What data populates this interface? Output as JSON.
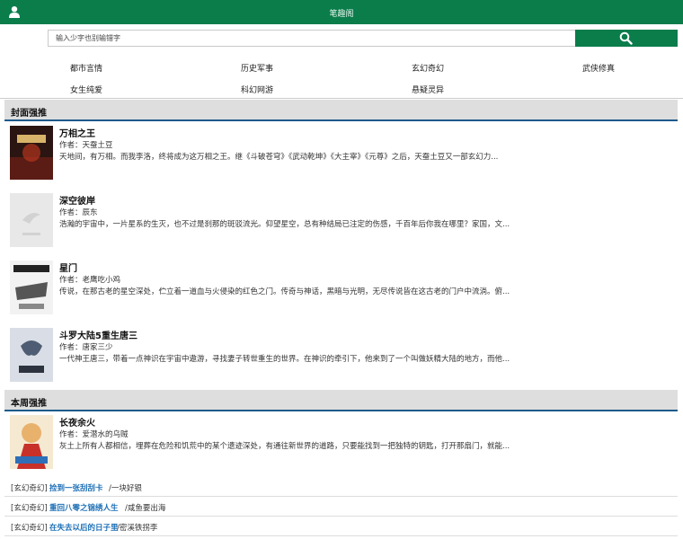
{
  "header": {
    "title": "笔趣阁",
    "user_icon": "user-icon"
  },
  "search": {
    "placeholder": "输入少字也别输错字",
    "button_icon": "search-icon"
  },
  "categories": [
    "都市言情",
    "历史军事",
    "玄幻奇幻",
    "武侠修真",
    "女生纯爱",
    "科幻网游",
    "悬疑灵异"
  ],
  "sections": {
    "cover": {
      "title": "封面强推"
    },
    "weekly": {
      "title": "本周强推"
    }
  },
  "cover_books": [
    {
      "title": "万相之王",
      "author": "作者：天蚕土豆",
      "desc": "天地间，有万相。而我李洛，终将成为这万相之王。继《斗破苍穹》《武动乾坤》《大主宰》《元尊》之后，天蚕土豆又一部玄幻力..."
    },
    {
      "title": "深空彼岸",
      "author": "作者：辰东",
      "desc": "浩瀚的宇宙中，一片星系的生灭，也不过是刹那的斑驳流光。仰望星空，总有种结局已注定的伤感，千百年后你我在哪里？家国，文..."
    },
    {
      "title": "星门",
      "author": "作者：老鹰吃小鸡",
      "desc": "传说，在那古老的星空深处，伫立着一道血与火侵染的红色之门。传奇与神话，黑暗与光明，无尽传说皆在这古老的门户中流淌。俯..."
    },
    {
      "title": "斗罗大陆5重生唐三",
      "author": "作者：唐家三少",
      "desc": "一代神王唐三，带着一点神识在宇宙中遨游，寻找妻子转世重生的世界。在神识的牵引下，他来到了一个叫做妖精大陆的地方，而他..."
    }
  ],
  "weekly_books": [
    {
      "title": "长夜余火",
      "author": "作者：爱潜水的乌贼",
      "desc": "灰土上所有人都相信，埋葬在危险和饥荒中的某个遗迹深处，有通往新世界的道路，只要能找到一把独特的钥匙，打开那扇门，就能..."
    }
  ],
  "list": [
    {
      "category": "[玄幻奇幻]",
      "title": "捡到一张刮刮卡",
      "author": "/一块好银"
    },
    {
      "category": "[玄幻奇幻]",
      "title": "重回八零之锦绣人生",
      "author": "/咸鱼要出海"
    },
    {
      "category": "[玄幻奇幻]",
      "title": "在失去以后的日子里",
      "author": "/密溪铁拐李"
    }
  ],
  "colors": {
    "brand": "#0a7d4b",
    "section_border": "#1e5a8c",
    "link": "#1c6fb5"
  }
}
